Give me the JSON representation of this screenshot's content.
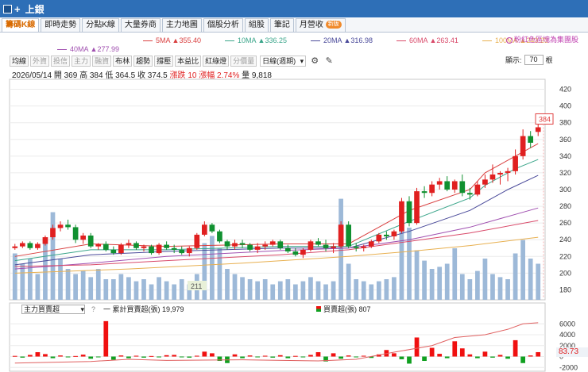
{
  "window": {
    "title": "上銀"
  },
  "tabs": [
    {
      "label": "籌碼K線",
      "active": true
    },
    {
      "label": "即時走勢"
    },
    {
      "label": "分點K線"
    },
    {
      "label": "大量券商"
    },
    {
      "label": "主力地圖"
    },
    {
      "label": "個股分析"
    },
    {
      "label": "組股"
    },
    {
      "label": "筆記"
    },
    {
      "label": "月營收",
      "badge": "新版"
    }
  ],
  "ma_legend": [
    {
      "name": "5MA",
      "arrow": "▲",
      "value": "355.40",
      "color": "#d94040"
    },
    {
      "name": "10MA",
      "arrow": "▲",
      "value": "336.25",
      "color": "#3aa58a"
    },
    {
      "name": "20MA",
      "arrow": "▲",
      "value": "316.98",
      "color": "#4a4a9a"
    },
    {
      "name": "60MA",
      "arrow": "▲",
      "value": "263.41",
      "color": "#d94a6a"
    },
    {
      "name": "100MA",
      "arrow": "▲",
      "value": "243.23",
      "color": "#e8b050"
    },
    {
      "name": "40MA",
      "arrow": "▲",
      "value": "277.99",
      "color": "#a050b0"
    }
  ],
  "hint": "粉紅色區塊為集團股",
  "toolbar": {
    "buttons": [
      {
        "label": "均線"
      },
      {
        "label": "外資",
        "dim": true
      },
      {
        "label": "投信",
        "dim": true
      },
      {
        "label": "主力",
        "dim": true
      },
      {
        "label": "融資",
        "dim": true
      },
      {
        "label": "布林"
      },
      {
        "label": "趨勢"
      },
      {
        "label": "撐壓"
      },
      {
        "label": "本益比"
      },
      {
        "label": "紅綠燈"
      },
      {
        "label": "分價量",
        "dim": true
      }
    ],
    "period_select": "日線(週期)",
    "gear_icon": "gear-icon",
    "draw_icon": "pen-icon",
    "display_label": "顯示:",
    "display_value": "70",
    "display_unit": "根"
  },
  "quote": {
    "date": "2026/05/14",
    "open_label": "開",
    "open": "369",
    "high_label": "高",
    "high": "384",
    "low_label": "低",
    "low": "364.5",
    "close_label": "收",
    "close": "374.5",
    "change_label": "漲跌",
    "change": "10",
    "pct_label": "漲幅",
    "pct": "2.74%",
    "vol_label": "量",
    "vol": "9,818"
  },
  "sub_panel": {
    "indicator_select": "主力買賣超",
    "help": "?",
    "legend_cum_label": "一 累計買賣超(張)",
    "legend_cum_value": "19,979",
    "legend_net_label": "買賣超(張)",
    "legend_net_value": "807",
    "last_value": "83.73",
    "colors": {
      "up": "#f01010",
      "down": "#10a020",
      "line": "#e06060"
    }
  },
  "chart_data": {
    "type": "candlestick",
    "price_axis": {
      "min": 170,
      "max": 430,
      "ticks": [
        180,
        200,
        220,
        240,
        260,
        280,
        300,
        320,
        340,
        360,
        380,
        400,
        420
      ]
    },
    "price_flag": "384",
    "vol_flag": "211",
    "sub_axis": {
      "min": -2400,
      "max": 7500,
      "ticks": [
        -2000,
        0,
        2000,
        4000,
        6000
      ]
    },
    "ma_lines": {
      "ma5": [
        [
          0,
          220
        ],
        [
          10,
          235
        ],
        [
          20,
          232
        ],
        [
          35,
          235
        ],
        [
          44,
          235
        ],
        [
          52,
          275
        ],
        [
          60,
          300
        ],
        [
          62,
          320
        ],
        [
          66,
          340
        ],
        [
          69,
          355
        ]
      ],
      "ma10": [
        [
          0,
          215
        ],
        [
          10,
          228
        ],
        [
          20,
          228
        ],
        [
          35,
          232
        ],
        [
          44,
          232
        ],
        [
          52,
          262
        ],
        [
          60,
          290
        ],
        [
          62,
          305
        ],
        [
          66,
          325
        ],
        [
          69,
          336
        ]
      ],
      "ma20": [
        [
          0,
          210
        ],
        [
          10,
          222
        ],
        [
          20,
          226
        ],
        [
          35,
          230
        ],
        [
          44,
          230
        ],
        [
          52,
          250
        ],
        [
          60,
          275
        ],
        [
          65,
          300
        ],
        [
          69,
          317
        ]
      ],
      "ma40": [
        [
          0,
          205
        ],
        [
          10,
          212
        ],
        [
          20,
          220
        ],
        [
          35,
          227
        ],
        [
          44,
          230
        ],
        [
          52,
          240
        ],
        [
          60,
          255
        ],
        [
          69,
          278
        ]
      ],
      "ma60": [
        [
          0,
          208
        ],
        [
          10,
          210
        ],
        [
          20,
          215
        ],
        [
          35,
          222
        ],
        [
          44,
          228
        ],
        [
          52,
          238
        ],
        [
          60,
          248
        ],
        [
          69,
          263
        ]
      ],
      "ma100": [
        [
          0,
          200
        ],
        [
          15,
          205
        ],
        [
          30,
          212
        ],
        [
          44,
          220
        ],
        [
          52,
          226
        ],
        [
          60,
          233
        ],
        [
          69,
          243
        ]
      ]
    },
    "candles": [
      [
        230,
        235,
        228,
        232
      ],
      [
        232,
        238,
        230,
        236
      ],
      [
        236,
        238,
        228,
        230
      ],
      [
        230,
        237,
        228,
        235
      ],
      [
        235,
        245,
        233,
        243
      ],
      [
        243,
        258,
        240,
        254
      ],
      [
        254,
        262,
        250,
        258
      ],
      [
        258,
        264,
        252,
        255
      ],
      [
        255,
        258,
        236,
        240
      ],
      [
        240,
        248,
        235,
        245
      ],
      [
        245,
        248,
        230,
        232
      ],
      [
        232,
        236,
        228,
        235
      ],
      [
        235,
        238,
        226,
        228
      ],
      [
        228,
        232,
        222,
        224
      ],
      [
        224,
        236,
        222,
        234
      ],
      [
        234,
        240,
        230,
        236
      ],
      [
        236,
        238,
        228,
        230
      ],
      [
        230,
        234,
        226,
        232
      ],
      [
        232,
        234,
        222,
        224
      ],
      [
        224,
        236,
        222,
        234
      ],
      [
        234,
        238,
        228,
        230
      ],
      [
        230,
        234,
        224,
        228
      ],
      [
        228,
        232,
        222,
        224
      ],
      [
        224,
        232,
        220,
        230
      ],
      [
        230,
        248,
        228,
        246
      ],
      [
        246,
        262,
        244,
        258
      ],
      [
        258,
        260,
        248,
        250
      ],
      [
        250,
        252,
        236,
        238
      ],
      [
        238,
        240,
        228,
        232
      ],
      [
        232,
        240,
        228,
        236
      ],
      [
        236,
        240,
        230,
        234
      ],
      [
        234,
        236,
        226,
        228
      ],
      [
        228,
        236,
        224,
        232
      ],
      [
        232,
        238,
        228,
        234
      ],
      [
        234,
        240,
        232,
        238
      ],
      [
        238,
        240,
        228,
        230
      ],
      [
        230,
        234,
        224,
        226
      ],
      [
        226,
        230,
        220,
        222
      ],
      [
        222,
        230,
        218,
        228
      ],
      [
        228,
        240,
        226,
        238
      ],
      [
        238,
        242,
        232,
        234
      ],
      [
        234,
        240,
        226,
        230
      ],
      [
        230,
        236,
        224,
        232
      ],
      [
        232,
        262,
        230,
        258
      ],
      [
        258,
        262,
        230,
        232
      ],
      [
        232,
        236,
        226,
        230
      ],
      [
        230,
        234,
        226,
        232
      ],
      [
        232,
        240,
        230,
        238
      ],
      [
        238,
        248,
        236,
        246
      ],
      [
        246,
        250,
        240,
        244
      ],
      [
        244,
        252,
        240,
        250
      ],
      [
        250,
        290,
        248,
        286
      ],
      [
        286,
        292,
        256,
        260
      ],
      [
        260,
        302,
        258,
        298
      ],
      [
        298,
        304,
        290,
        296
      ],
      [
        296,
        310,
        292,
        306
      ],
      [
        306,
        314,
        300,
        310
      ],
      [
        310,
        316,
        298,
        300
      ],
      [
        300,
        312,
        296,
        310
      ],
      [
        310,
        318,
        292,
        296
      ],
      [
        296,
        302,
        288,
        294
      ],
      [
        294,
        310,
        292,
        306
      ],
      [
        306,
        318,
        302,
        312
      ],
      [
        312,
        330,
        308,
        318
      ],
      [
        318,
        322,
        306,
        320
      ],
      [
        320,
        326,
        310,
        322
      ],
      [
        322,
        348,
        318,
        340
      ],
      [
        340,
        372,
        336,
        364
      ],
      [
        364,
        370,
        350,
        356
      ],
      [
        369,
        384,
        364,
        374.5
      ]
    ],
    "volume": [
      45,
      35,
      40,
      25,
      60,
      85,
      40,
      30,
      25,
      28,
      22,
      30,
      20,
      20,
      25,
      22,
      18,
      20,
      15,
      22,
      18,
      15,
      20,
      15,
      25,
      55,
      62,
      50,
      30,
      25,
      22,
      20,
      18,
      20,
      15,
      18,
      20,
      15,
      18,
      22,
      18,
      15,
      18,
      98,
      35,
      20,
      18,
      15,
      18,
      20,
      22,
      95,
      70,
      48,
      38,
      30,
      32,
      35,
      50,
      25,
      20,
      28,
      40,
      25,
      22,
      20,
      45,
      58,
      40,
      35
    ],
    "sub_bars": [
      120,
      -200,
      300,
      800,
      450,
      -300,
      200,
      -150,
      100,
      350,
      -400,
      -100,
      6500,
      -600,
      200,
      -300,
      150,
      -200,
      100,
      -150,
      250,
      300,
      -100,
      -200,
      150,
      900,
      600,
      -800,
      -1200,
      400,
      -300,
      200,
      -100,
      150,
      -200,
      250,
      -300,
      120,
      -150,
      300,
      800,
      -900,
      600,
      -400,
      200,
      -100,
      150,
      -250,
      400,
      1200,
      600,
      -500,
      -1300,
      3500,
      -800,
      1600,
      500,
      -300,
      2800,
      1500,
      400,
      -300,
      900,
      -200,
      300,
      -400,
      3000,
      -1200,
      200,
      807
    ],
    "sub_cum": [
      [
        0,
        -1200
      ],
      [
        10,
        -900
      ],
      [
        15,
        -500
      ],
      [
        20,
        -700
      ],
      [
        30,
        -600
      ],
      [
        40,
        -800
      ],
      [
        45,
        -500
      ],
      [
        50,
        800
      ],
      [
        55,
        2000
      ],
      [
        58,
        3500
      ],
      [
        62,
        4000
      ],
      [
        65,
        5000
      ],
      [
        67,
        6000
      ],
      [
        69,
        6200
      ]
    ]
  }
}
